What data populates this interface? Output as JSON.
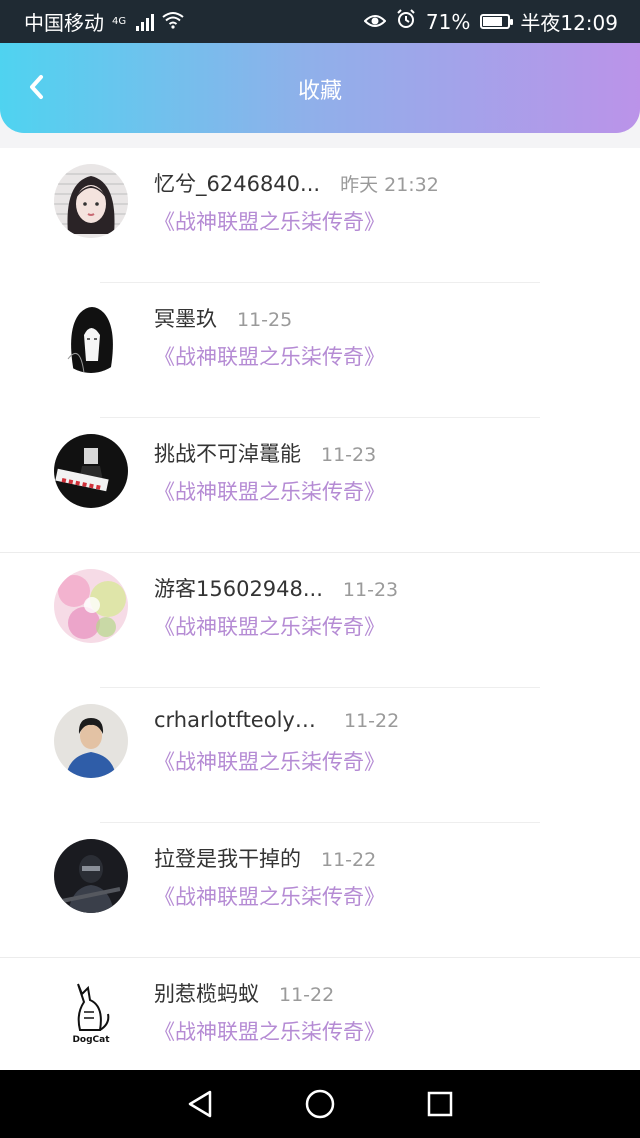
{
  "status_bar": {
    "carrier": "中国移动",
    "network": "4G",
    "battery": "71%",
    "time": "半夜12:09"
  },
  "header": {
    "title": "收藏"
  },
  "items": [
    {
      "name": "忆兮_6246840...",
      "time": "昨天 21:32",
      "topic": "《战神联盟之乐柒传奇》",
      "avatar": "avatar-girl-portrait"
    },
    {
      "name": "冥墨玖",
      "time": "11-25",
      "topic": "《战神联盟之乐柒传奇》",
      "avatar": "avatar-anime-girl"
    },
    {
      "name": "挑战不可淖鼍能",
      "time": "11-23",
      "topic": "《战神联盟之乐柒传奇》",
      "avatar": "avatar-dark-figure"
    },
    {
      "name": "游客15602948...",
      "time": "11-23",
      "topic": "《战神联盟之乐柒传奇》",
      "avatar": "avatar-flowers"
    },
    {
      "name": "crharlotfteolym...",
      "time": "11-22",
      "topic": "《战神联盟之乐柒传奇》",
      "avatar": "avatar-boy-photo"
    },
    {
      "name": "拉登是我干掉的",
      "time": "11-22",
      "topic": "《战神联盟之乐柒传奇》",
      "avatar": "avatar-soldier"
    },
    {
      "name": "别惹榄蚂蚁",
      "time": "11-22",
      "topic": "《战神联盟之乐柒传奇》",
      "avatar": "avatar-dogcat-logo",
      "avatar_text": "DogCat"
    }
  ],
  "colors": {
    "accent_start": "#4fd3f0",
    "accent_end": "#bb93e9",
    "topic": "#b58bd4"
  }
}
